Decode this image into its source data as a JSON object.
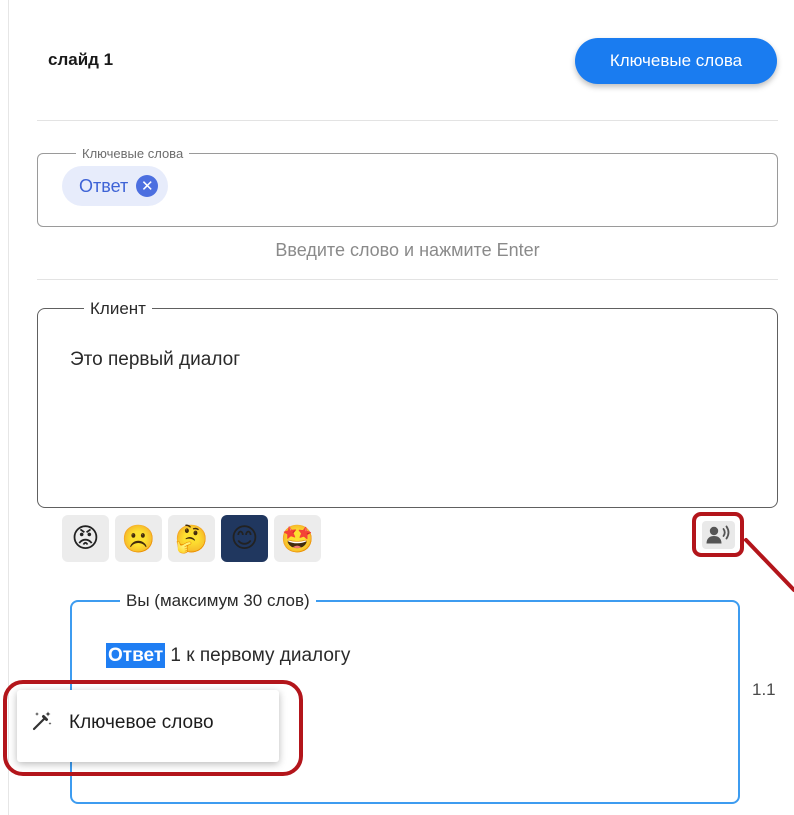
{
  "slide": {
    "title": "слайд 1",
    "keywords_button": "Ключевые слова"
  },
  "keywords": {
    "legend": "Ключевые слова",
    "chips": [
      {
        "label": "Ответ"
      }
    ],
    "helper": "Введите слово и нажмите Enter"
  },
  "client": {
    "legend": "Клиент",
    "text": "Это первый диалог"
  },
  "emotions": {
    "items": [
      {
        "name": "angry",
        "glyph": "😡"
      },
      {
        "name": "sad",
        "glyph": "☹️"
      },
      {
        "name": "thinking",
        "glyph": "🤔"
      },
      {
        "name": "smile",
        "glyph": "😊",
        "selected": true
      },
      {
        "name": "star-struck",
        "glyph": "🤩"
      }
    ]
  },
  "voice_icon": "speaking-person-icon",
  "you": {
    "legend": "Вы (максимум 30 слов)",
    "highlighted": "Ответ",
    "rest": "1 к первому диалогу"
  },
  "row_number": "1.1",
  "context_menu": {
    "icon": "magic-wand-icon",
    "label": "Ключевое слово"
  },
  "colors": {
    "accent": "#1a7cf0",
    "annotation": "#b3151b",
    "selected_emoji_bg": "#20375f",
    "chip_bg": "#e7ecfb"
  }
}
